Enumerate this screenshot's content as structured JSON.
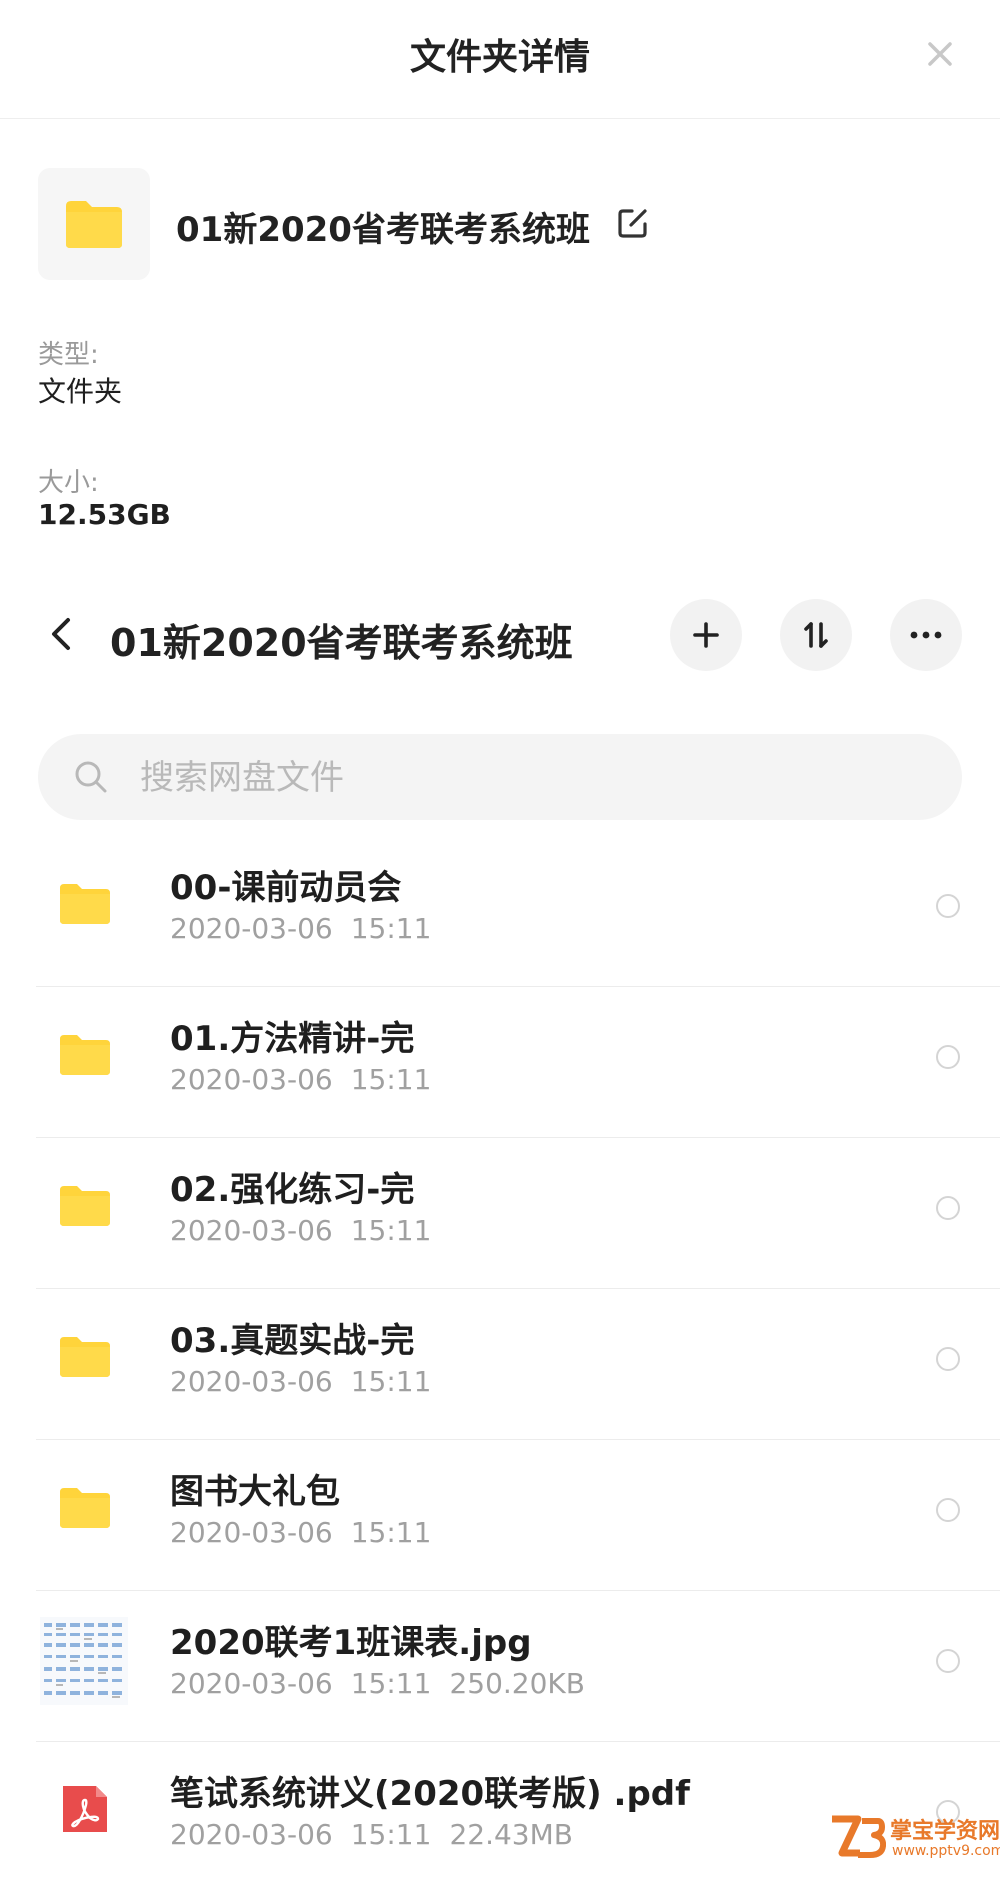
{
  "header": {
    "title": "文件夹详情"
  },
  "details": {
    "folder_name": "01新2020省考联考系统班",
    "type_label": "类型:",
    "type_value": "文件夹",
    "size_label": "大小:",
    "size_value": "12.53GB"
  },
  "nav": {
    "title": "01新2020省考联考系统班"
  },
  "search": {
    "placeholder": "搜索网盘文件"
  },
  "files": [
    {
      "name": "00-课前动员会",
      "date": "2020-03-06",
      "time": "15:11",
      "size": "",
      "icon": "folder-icon"
    },
    {
      "name": "01.方法精讲-完",
      "date": "2020-03-06",
      "time": "15:11",
      "size": "",
      "icon": "folder-icon"
    },
    {
      "name": "02.强化练习-完",
      "date": "2020-03-06",
      "time": "15:11",
      "size": "",
      "icon": "folder-icon"
    },
    {
      "name": "03.真题实战-完",
      "date": "2020-03-06",
      "time": "15:11",
      "size": "",
      "icon": "folder-icon"
    },
    {
      "name": "图书大礼包",
      "date": "2020-03-06",
      "time": "15:11",
      "size": "",
      "icon": "folder-icon"
    },
    {
      "name": "2020联考1班课表.jpg",
      "date": "2020-03-06",
      "time": "15:11",
      "size": "250.20KB",
      "icon": "image-thumbnail-icon"
    },
    {
      "name": "笔试系统讲义(2020联考版) .pdf",
      "date": "2020-03-06",
      "time": "15:11",
      "size": "22.43MB",
      "icon": "pdf-icon"
    }
  ],
  "watermark": {
    "name": "掌宝学资网",
    "url": "www.pptv9.com"
  },
  "colors": {
    "folder_yellow": "#FFD43B",
    "pdf_red": "#E84C4C",
    "watermark_orange": "#E8792A"
  }
}
